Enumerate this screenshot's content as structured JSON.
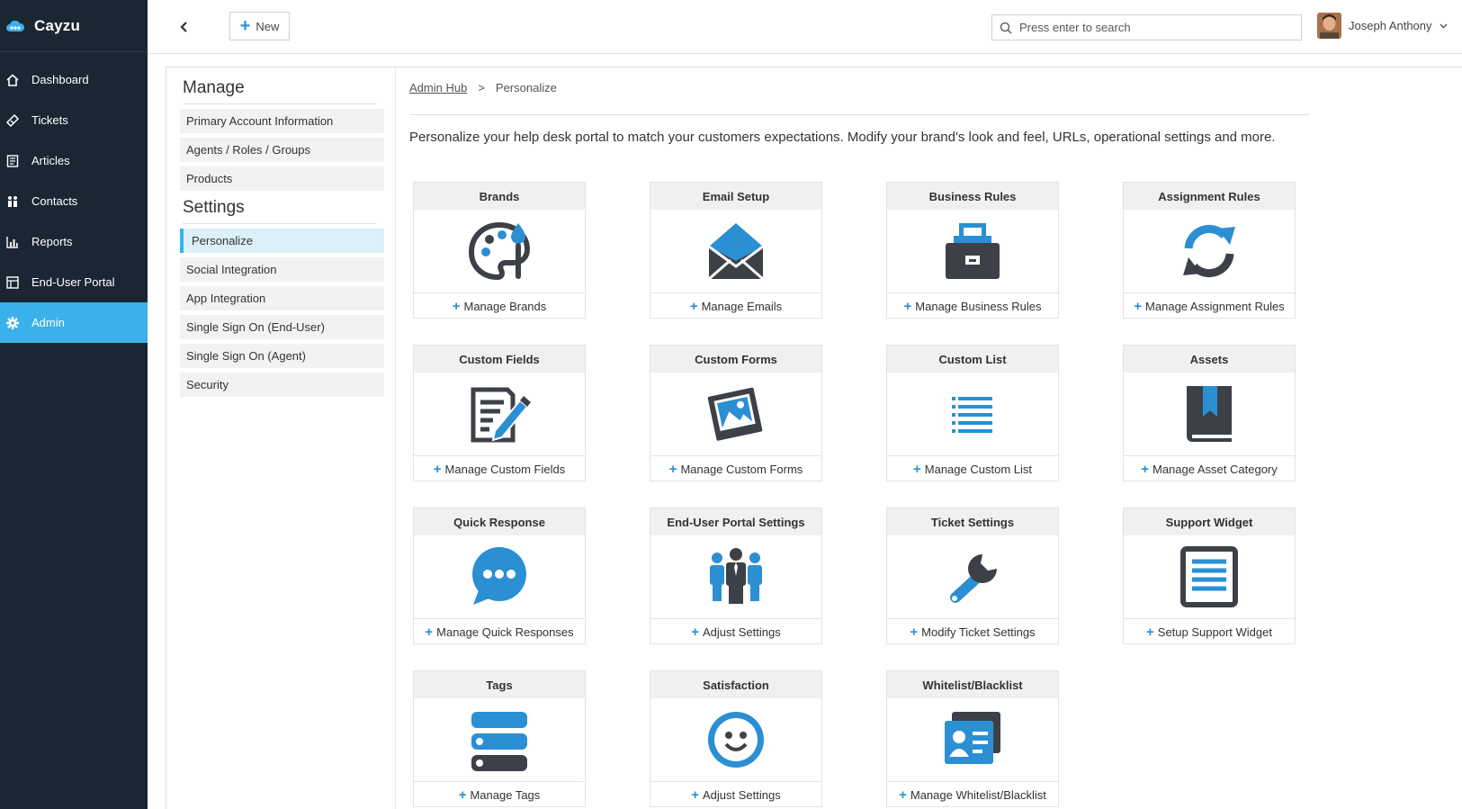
{
  "app": {
    "name": "Cayzu"
  },
  "nav": {
    "items": [
      {
        "label": "Dashboard",
        "icon": "home-icon"
      },
      {
        "label": "Tickets",
        "icon": "ticket-icon"
      },
      {
        "label": "Articles",
        "icon": "article-icon"
      },
      {
        "label": "Contacts",
        "icon": "contacts-icon"
      },
      {
        "label": "Reports",
        "icon": "reports-icon"
      },
      {
        "label": "End-User Portal",
        "icon": "portal-icon"
      },
      {
        "label": "Admin",
        "icon": "gear-icon",
        "active": true
      }
    ]
  },
  "topbar": {
    "new_label": "New",
    "search_placeholder": "Press enter to search",
    "user_name": "Joseph Anthony"
  },
  "sidebar": {
    "manage_heading": "Manage",
    "manage_items": [
      "Primary Account Information",
      "Agents / Roles / Groups",
      "Products"
    ],
    "settings_heading": "Settings",
    "settings_items": [
      "Personalize",
      "Social Integration",
      "App Integration",
      "Single Sign On (End-User)",
      "Single Sign On (Agent)",
      "Security"
    ],
    "active_item": "Personalize"
  },
  "breadcrumb": {
    "root": "Admin Hub",
    "separator": ">",
    "current": "Personalize"
  },
  "intro": "Personalize your help desk portal to match your customers expectations. Modify your brand's look and feel, URLs, operational settings and more.",
  "cards": [
    {
      "title": "Brands",
      "link": "Manage Brands",
      "icon": "palette-icon"
    },
    {
      "title": "Email Setup",
      "link": "Manage Emails",
      "icon": "envelope-icon"
    },
    {
      "title": "Business Rules",
      "link": "Manage Business Rules",
      "icon": "toolbox-icon"
    },
    {
      "title": "Assignment Rules",
      "link": "Manage Assignment Rules",
      "icon": "refresh-icon"
    },
    {
      "title": "Custom Fields",
      "link": "Manage Custom Fields",
      "icon": "edit-document-icon"
    },
    {
      "title": "Custom Forms",
      "link": "Manage Custom Forms",
      "icon": "picture-icon"
    },
    {
      "title": "Custom List",
      "link": "Manage Custom List",
      "icon": "list-icon"
    },
    {
      "title": "Assets",
      "link": "Manage Asset Category",
      "icon": "book-icon"
    },
    {
      "title": "Quick Response",
      "link": "Manage Quick Responses",
      "icon": "chat-bubble-icon"
    },
    {
      "title": "End-User Portal Settings",
      "link": "Adjust Settings",
      "icon": "people-icon"
    },
    {
      "title": "Ticket Settings",
      "link": "Modify Ticket Settings",
      "icon": "wrench-icon"
    },
    {
      "title": "Support Widget",
      "link": "Setup Support Widget",
      "icon": "widget-document-icon"
    },
    {
      "title": "Tags",
      "link": "Manage Tags",
      "icon": "tags-icon"
    },
    {
      "title": "Satisfaction",
      "link": "Adjust Settings",
      "icon": "smiley-icon"
    },
    {
      "title": "Whitelist/Blacklist",
      "link": "Manage Whitelist/Blacklist",
      "icon": "id-card-icon"
    }
  ],
  "colors": {
    "nav_bg": "#1a2733",
    "accent": "#3bb1ec",
    "icon_blue": "#2a8fd3",
    "icon_dark": "#3d4147"
  }
}
